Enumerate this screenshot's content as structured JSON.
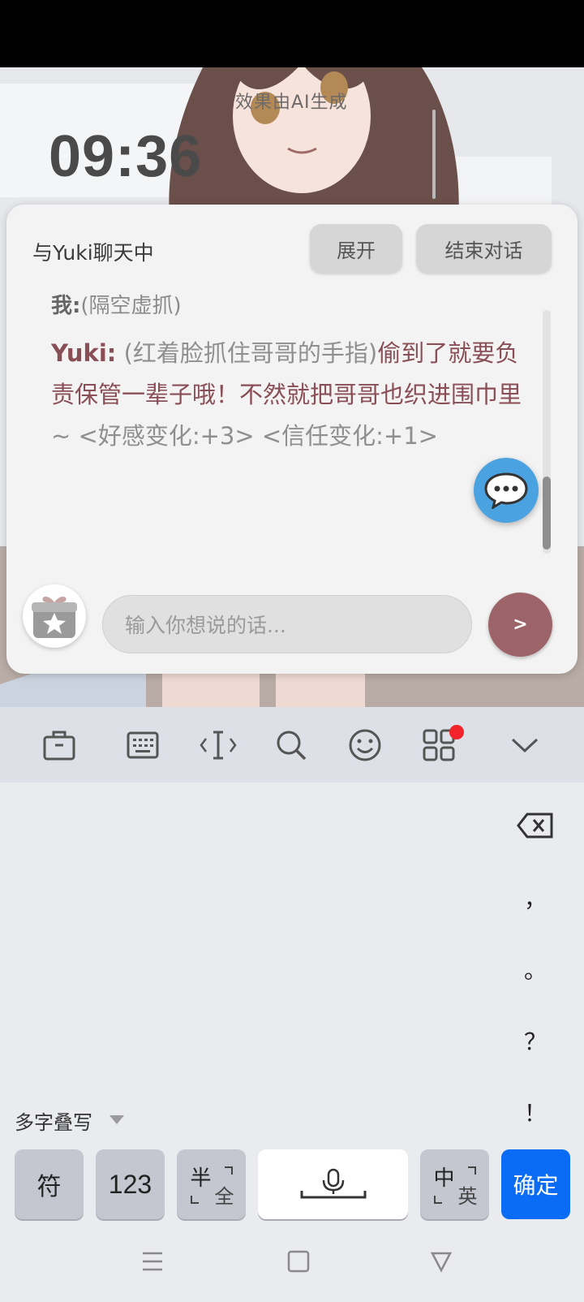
{
  "overlay": {
    "gen_label": "效果由AI生成",
    "clock": "09:36"
  },
  "chat": {
    "title": "与Yuki聊天中",
    "expand_label": "展开",
    "end_label": "结束对话",
    "messages": {
      "me_speaker": "我:",
      "me_text": "(隔空虚抓)",
      "yuki_speaker": "Yuki:",
      "yuki_action": "(红着脸抓住哥哥的手指)",
      "yuki_text": "偷到了就要负责保管一辈子哦！不然就把哥哥也织进围巾里",
      "yuki_stats": " ~ <好感变化:+3> <信任变化:+1>"
    },
    "input_placeholder": "输入你想说的话...",
    "send_label": ">",
    "icons": {
      "gift": "gift-star-icon",
      "fab": "speech-bubble-icon"
    }
  },
  "keyboard": {
    "toolbar_icons": [
      "briefcase-icon",
      "keyboard-icon",
      "cursor-icon",
      "search-icon",
      "emoji-icon",
      "apps-grid-icon",
      "chevron-down-icon"
    ],
    "punctuation": [
      "，",
      "。",
      "？",
      "！"
    ],
    "multi_write": "多字叠写",
    "keys": {
      "symbol": "符",
      "numbers": "123",
      "half_top": "半",
      "half_bottom": "全",
      "cn_top": "中",
      "cn_bottom": "英",
      "confirm": "确定"
    },
    "accent": "#0a6cf5"
  },
  "navbar": {
    "icons": [
      "menu-icon",
      "home-square-icon",
      "back-triangle-icon"
    ]
  }
}
